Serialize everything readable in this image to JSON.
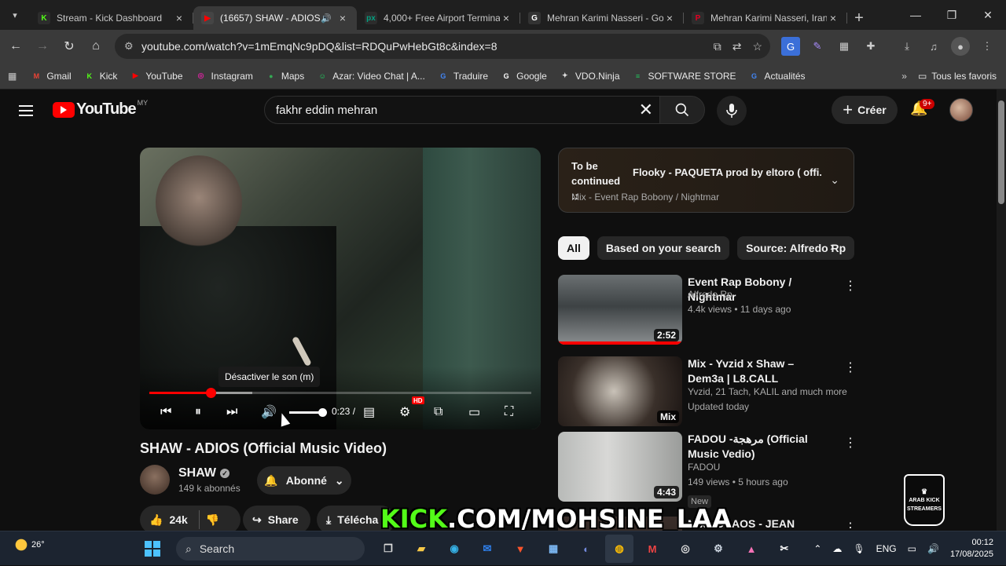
{
  "tabs": [
    {
      "title": "Stream - Kick Dashboard",
      "icon": "K",
      "color": "#53fc18",
      "active": false
    },
    {
      "title": "(16657) SHAW - ADIOS (",
      "icon": "▶",
      "color": "#ff0000",
      "active": true
    },
    {
      "title": "4,000+ Free Airport Termina",
      "icon": "px",
      "color": "#05a081",
      "active": false
    },
    {
      "title": "Mehran Karimi Nasseri - Go",
      "icon": "G",
      "color": "#ffffff",
      "active": false
    },
    {
      "title": "Mehran Karimi Nasseri, Irani",
      "icon": "P",
      "color": "#e60023",
      "active": false
    }
  ],
  "url": "youtube.com/watch?v=1mEmqNc9pDQ&list=RDQuPwHebGt8c&index=8",
  "bookmarks": [
    {
      "label": "Gmail",
      "icon": "M",
      "color": "#ea4335"
    },
    {
      "label": "Kick",
      "icon": "K",
      "color": "#53fc18"
    },
    {
      "label": "YouTube",
      "icon": "▶",
      "color": "#ff0000"
    },
    {
      "label": "Instagram",
      "icon": "◎",
      "color": "#d6249f"
    },
    {
      "label": "Maps",
      "icon": "●",
      "color": "#34a853"
    },
    {
      "label": "Azar: Video Chat | A...",
      "icon": "☺",
      "color": "#1ed760"
    },
    {
      "label": "Traduire",
      "icon": "G",
      "color": "#4285f4"
    },
    {
      "label": "Google",
      "icon": "G",
      "color": "#ffffff"
    },
    {
      "label": "VDO.Ninja",
      "icon": "✦",
      "color": "#dddddd"
    },
    {
      "label": "SOFTWARE STORE",
      "icon": "≡",
      "color": "#22c55e"
    },
    {
      "label": "Actualités",
      "icon": "G",
      "color": "#4285f4"
    }
  ],
  "all_bookmarks": "Tous les favoris",
  "yt": {
    "country": "MY",
    "logo_word": "YouTube",
    "search_value": "fakhr eddin mehran",
    "create_label": "Créer",
    "notif_badge": "9+"
  },
  "player": {
    "tooltip": "Désactiver le son (m)",
    "time": "0:23 /",
    "progress_fraction": 0.16,
    "buffered_fraction": 0.27,
    "volume_fraction": 1.0,
    "hd_badge": "HD"
  },
  "video": {
    "title": "SHAW - ADIOS (Official Music Video)",
    "channel": "SHAW",
    "subscribers": "149 k abonnés",
    "subscribed_label": "Abonné",
    "likes": "24k",
    "share": "Share",
    "download": "Télécha"
  },
  "upnext": {
    "label": "To be continued ::",
    "song": "Flooky - PAQUETA prod by eltoro ( offi...",
    "mix": "Mix - Event Rap Bobony / Nightmar"
  },
  "chips": [
    "All",
    "Based on your search",
    "Source: Alfredo Rp"
  ],
  "recs": [
    {
      "title": "Event Rap Bobony / Nightmar",
      "channel": "Alfredo Rp",
      "meta": "4.4k views • 11 days ago",
      "badge": "2:52",
      "new": ""
    },
    {
      "title": "Mix - Yvzid x Shaw – Dem3a | L8.CALL",
      "channel": "Yvzid, 21 Tach, KALIL and much more",
      "meta": "Updated today",
      "badge": "Mix",
      "new": ""
    },
    {
      "title": "FADOU -مرهجة (Official Music Vedio)",
      "channel": "FADOU",
      "meta": "149 views • 5 hours ago",
      "badge": "4:43",
      "new": "New"
    },
    {
      "title": "Mix - CHAOS - JEAN",
      "channel": "",
      "meta": "",
      "badge": "",
      "new": ""
    }
  ],
  "overlay": {
    "brand": "KICK",
    "rest": ".COM/MOHSINE_LAA"
  },
  "watermark": "ARAB KICK STREAMERS",
  "taskbar": {
    "temp": "26°",
    "search": "Search",
    "lang": "ENG",
    "time": "00:12",
    "date": "17/08/2025"
  }
}
